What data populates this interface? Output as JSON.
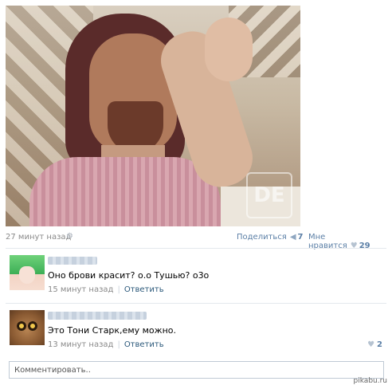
{
  "post": {
    "time": "27 минут назад",
    "share_label": "Поделиться",
    "share_count": "7",
    "like_label": "Мне нравится",
    "like_count": "29",
    "watermark_logo": "DE"
  },
  "comments": [
    {
      "text": "Оно брови красит? о.о Тушью? о3о",
      "time": "15 минут назад",
      "reply": "Ответить",
      "likes": ""
    },
    {
      "text": "Это Тони Старк,ему можно.",
      "time": "13 минут назад",
      "reply": "Ответить",
      "likes": "2"
    }
  ],
  "comment_box": {
    "placeholder": "Комментировать.."
  },
  "site_watermark": "pikabu.ru",
  "colors": {
    "link": "#2b587a",
    "muted": "#8a8a8a",
    "accent": "#5b7fa6"
  }
}
